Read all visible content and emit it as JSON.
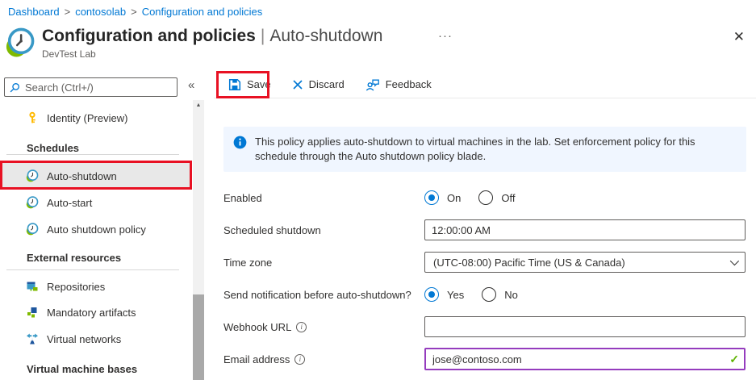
{
  "breadcrumb": {
    "separator": ">",
    "items": [
      "Dashboard",
      "contosolab",
      "Configuration and policies"
    ]
  },
  "header": {
    "title": "Configuration and policies",
    "separator": "|",
    "context": "Auto-shutdown",
    "subtitle": "DevTest Lab",
    "more_label": "···",
    "close_label": "✕"
  },
  "sidebar": {
    "search": {
      "placeholder": "Search (Ctrl+/)"
    },
    "collapse_glyph": "«",
    "scroll_up_glyph": "▲",
    "items": [
      {
        "label": "Identity (Preview)",
        "icon": "key-icon",
        "type": "item"
      },
      {
        "label": "Schedules",
        "type": "header"
      },
      {
        "label": "Auto-shutdown",
        "icon": "clock-icon",
        "type": "item",
        "selected": true,
        "annotated": true
      },
      {
        "label": "Auto-start",
        "icon": "clock-icon",
        "type": "item"
      },
      {
        "label": "Auto shutdown policy",
        "icon": "clock-icon",
        "type": "item"
      },
      {
        "label": "External resources",
        "type": "header"
      },
      {
        "label": "Repositories",
        "icon": "repository-icon",
        "type": "item"
      },
      {
        "label": "Mandatory artifacts",
        "icon": "artifacts-icon",
        "type": "item"
      },
      {
        "label": "Virtual networks",
        "icon": "network-icon",
        "type": "item"
      },
      {
        "label": "Virtual machine bases",
        "type": "header"
      }
    ]
  },
  "toolbar": {
    "save_label": "Save",
    "discard_label": "Discard",
    "feedback_label": "Feedback"
  },
  "banner": {
    "text": "This policy applies auto-shutdown to virtual machines in the lab. Set enforcement policy for this schedule through the Auto shutdown policy blade."
  },
  "form": {
    "enabled": {
      "label": "Enabled",
      "options": [
        "On",
        "Off"
      ],
      "selected": "On"
    },
    "scheduled_shutdown": {
      "label": "Scheduled shutdown",
      "value": "12:00:00 AM"
    },
    "time_zone": {
      "label": "Time zone",
      "value": "(UTC-08:00) Pacific Time (US & Canada)"
    },
    "send_notification": {
      "label": "Send notification before auto-shutdown?",
      "options": [
        "Yes",
        "No"
      ],
      "selected": "Yes"
    },
    "webhook_url": {
      "label": "Webhook URL",
      "value": ""
    },
    "email_address": {
      "label": "Email address",
      "value": "jose@contoso.com",
      "valid": true
    }
  },
  "icons": {
    "info_glyph": "i",
    "check_glyph": "✓"
  },
  "colors": {
    "accent": "#0078d4",
    "annotation_red": "#e81123",
    "valid_green": "#5db300",
    "email_focus_border": "#953cbe",
    "banner_bg": "#f0f6ff",
    "selected_item_bg": "#e8e8e8",
    "key_icon_yellow": "#ffb900"
  }
}
